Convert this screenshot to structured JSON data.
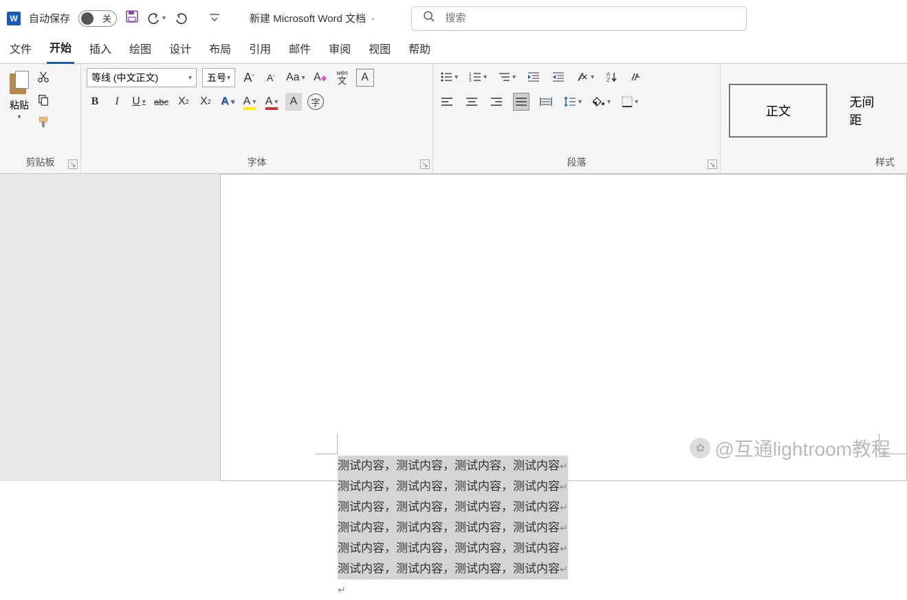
{
  "title_bar": {
    "app_letter": "W",
    "autosave_label": "自动保存",
    "toggle_state": "关",
    "doc_title": "新建 Microsoft Word 文档",
    "search_placeholder": "搜索"
  },
  "tabs": {
    "file": "文件",
    "home": "开始",
    "insert": "插入",
    "draw": "绘图",
    "design": "设计",
    "layout": "布局",
    "references": "引用",
    "mailings": "邮件",
    "review": "审阅",
    "view": "视图",
    "help": "帮助"
  },
  "ribbon": {
    "clipboard": {
      "label": "剪贴板",
      "paste": "粘贴"
    },
    "font": {
      "label": "字体",
      "name": "等线 (中文正文)",
      "size": "五号",
      "change_case": "Aa",
      "phonetic": "wén",
      "phonetic2": "文",
      "char_border": "A",
      "bold": "B",
      "italic": "I",
      "underline": "U",
      "strike": "abc",
      "subscript": "X",
      "superscript": "X",
      "text_effects": "A",
      "highlight": "A",
      "font_color": "A",
      "char_shading": "A",
      "enclose": "字"
    },
    "paragraph": {
      "label": "段落"
    },
    "styles": {
      "label": "样式",
      "normal": "正文",
      "no_spacing": "无间距"
    }
  },
  "document": {
    "lines": [
      "测试内容，测试内容，测试内容，测试内容",
      "测试内容，测试内容，测试内容，测试内容",
      "测试内容，测试内容，测试内容，测试内容",
      "测试内容，测试内容，测试内容，测试内容",
      "测试内容，测试内容，测试内容，测试内容",
      "测试内容，测试内容，测试内容，测试内容"
    ]
  },
  "watermark": "@互通lightroom教程"
}
